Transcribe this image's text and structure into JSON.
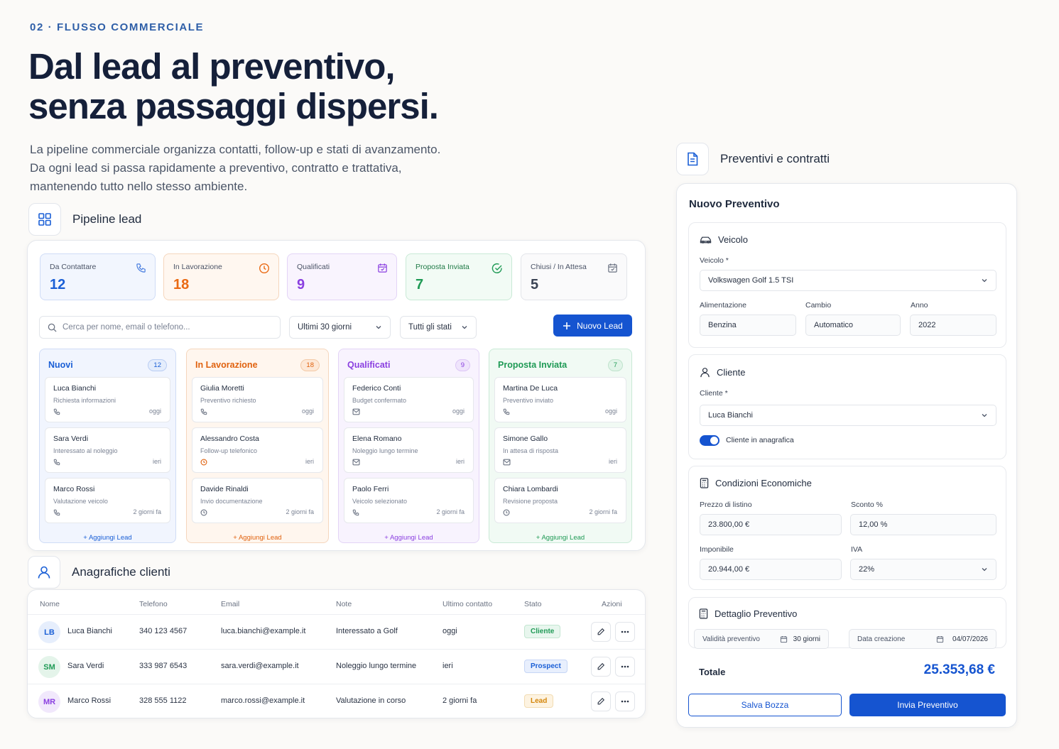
{
  "hero": {
    "eyebrow": "02 · FLUSSO COMMERCIALE",
    "headline_1": "Dal lead al preventivo,",
    "headline_2": "senza passaggi dispersi.",
    "intro_1": "La pipeline commerciale organizza contatti, follow-up e stati di avanzamento.",
    "intro_2": "Da ogni lead si passa rapidamente a preventivo, contratto e trattativa,",
    "intro_3": "mantenendo tutto nello stesso ambiente."
  },
  "pipeline": {
    "section_title": "Pipeline lead",
    "section_icon": "grid-icon",
    "kpis": [
      {
        "label": "Da Contattare",
        "value": "12",
        "icon": "phone-icon",
        "color": "#1a5fd6"
      },
      {
        "label": "In Lavorazione",
        "value": "18",
        "icon": "clock-icon",
        "color": "#ea6a14"
      },
      {
        "label": "Qualificati",
        "value": "9",
        "icon": "calendar-icon",
        "color": "#8a3fe0"
      },
      {
        "label": "Proposta Inviata",
        "value": "7",
        "icon": "check-circle-icon",
        "color": "#1f9a55"
      },
      {
        "label": "Chiusi / In Attesa",
        "value": "5",
        "icon": "calendar-icon",
        "color": "#3a4354"
      }
    ],
    "search_placeholder": "Cerca per nome, email o telefono...",
    "period_filter": "Ultimi 30 giorni",
    "status_filter": "Tutti gli stati",
    "new_lead_label": "Nuovo Lead",
    "add_lead_label": "+ Aggiungi Lead",
    "columns": [
      {
        "title": "Nuovi",
        "count": "12",
        "color": "#1a5fd6",
        "cards": [
          {
            "name": "Luca Bianchi",
            "desc": "Richiesta informazioni",
            "icon": "phone-icon",
            "time": "oggi"
          },
          {
            "name": "Sara Verdi",
            "desc": "Interessato al noleggio",
            "icon": "phone-icon",
            "time": "ieri"
          },
          {
            "name": "Marco Rossi",
            "desc": "Valutazione veicolo",
            "icon": "phone-icon",
            "time": "2 giorni fa"
          }
        ]
      },
      {
        "title": "In Lavorazione",
        "count": "18",
        "color": "#e0620f",
        "cards": [
          {
            "name": "Giulia Moretti",
            "desc": "Preventivo richiesto",
            "icon": "phone-icon",
            "time": "oggi"
          },
          {
            "name": "Alessandro Costa",
            "desc": "Follow-up telefonico",
            "icon": "clock-icon",
            "time": "ieri"
          },
          {
            "name": "Davide Rinaldi",
            "desc": "Invio documentazione",
            "icon": "clock-icon",
            "time": "2 giorni fa"
          }
        ]
      },
      {
        "title": "Qualificati",
        "count": "9",
        "color": "#8a3fe0",
        "cards": [
          {
            "name": "Federico Conti",
            "desc": "Budget confermato",
            "icon": "mail-icon",
            "time": "oggi"
          },
          {
            "name": "Elena Romano",
            "desc": "Noleggio lungo termine",
            "icon": "mail-icon",
            "time": "ieri"
          },
          {
            "name": "Paolo Ferri",
            "desc": "Veicolo selezionato",
            "icon": "phone-icon",
            "time": "2 giorni fa"
          }
        ]
      },
      {
        "title": "Proposta Inviata",
        "count": "7",
        "color": "#1f9a55",
        "cards": [
          {
            "name": "Martina De Luca",
            "desc": "Preventivo inviato",
            "icon": "phone-icon",
            "time": "oggi"
          },
          {
            "name": "Simone Gallo",
            "desc": "In attesa di risposta",
            "icon": "mail-icon",
            "time": "ieri"
          },
          {
            "name": "Chiara Lombardi",
            "desc": "Revisione proposta",
            "icon": "clock-icon",
            "time": "2 giorni fa"
          }
        ]
      }
    ]
  },
  "clients": {
    "section_title": "Anagrafiche clienti",
    "section_icon": "user-icon",
    "headers": [
      "Nome",
      "Telefono",
      "Email",
      "Note",
      "Ultimo contatto",
      "Stato",
      "Azioni"
    ],
    "rows": [
      {
        "initials": "LB",
        "name": "Luca Bianchi",
        "phone": "340 123 4567",
        "email": "luca.bianchi@example.it",
        "note": "Interessato a Golf",
        "last": "oggi",
        "status": "Cliente",
        "status_color": "#1f9a55"
      },
      {
        "initials": "SM",
        "name": "Sara Verdi",
        "phone": "333 987 6543",
        "email": "sara.verdi@example.it",
        "note": "Noleggio lungo termine",
        "last": "ieri",
        "status": "Prospect",
        "status_color": "#1a5fd6"
      },
      {
        "initials": "MR",
        "name": "Marco Rossi",
        "phone": "328 555 1122",
        "email": "marco.rossi@example.it",
        "note": "Valutazione in corso",
        "last": "2 giorni fa",
        "status": "Lead",
        "status_color": "#d4860b"
      }
    ]
  },
  "quote": {
    "section_title": "Preventivi e contratti",
    "section_icon": "document-icon",
    "panel_title": "Nuovo Preventivo",
    "vehicle": {
      "title": "Veicolo",
      "vehicle_label": "Veicolo *",
      "vehicle_value": "Volkswagen Golf 1.5 TSI",
      "fuel_label": "Alimentazione",
      "fuel_value": "Benzina",
      "gearbox_label": "Cambio",
      "gearbox_value": "Automatico",
      "year_label": "Anno",
      "year_value": "2022"
    },
    "client": {
      "title": "Cliente",
      "client_label": "Cliente *",
      "client_value": "Luca Bianchi",
      "toggle_label": "Cliente in anagrafica"
    },
    "economics": {
      "title": "Condizioni Economiche",
      "list_price_label": "Prezzo di listino",
      "list_price_value": "23.800,00 €",
      "discount_label": "Sconto %",
      "discount_value": "12,00 %",
      "taxable_label": "Imponibile",
      "taxable_value": "20.944,00 €",
      "vat_label": "IVA",
      "vat_value": "22%"
    },
    "detail": {
      "title": "Dettaglio Preventivo",
      "validity_label": "Validità preventivo",
      "validity_value": "30 giorni",
      "created_label": "Data creazione",
      "created_value": "04/07/2026",
      "total_label": "Totale",
      "total_value": "25.353,68 €"
    },
    "save_draft_label": "Salva Bozza",
    "send_label": "Invia Preventivo"
  }
}
